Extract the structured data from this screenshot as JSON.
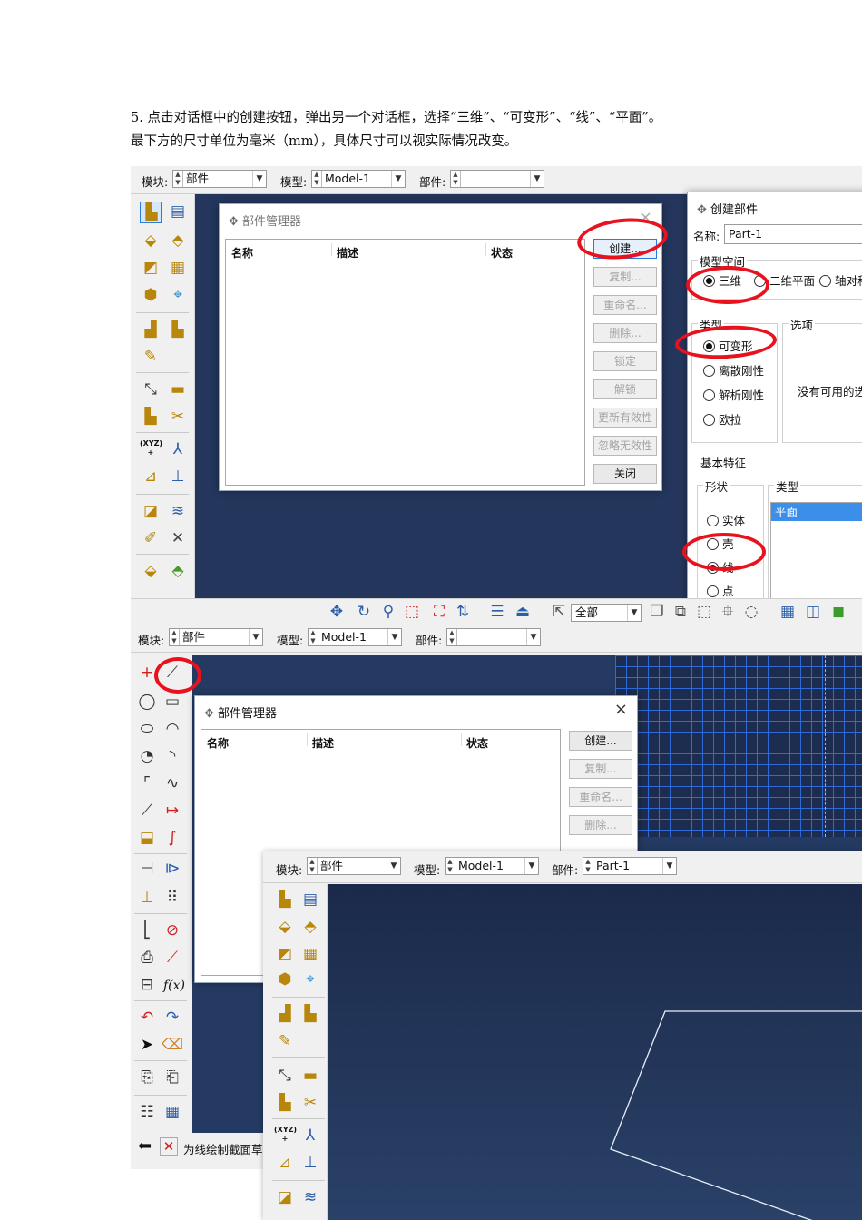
{
  "instructions": {
    "line1": "5. 点击对话框中的创建按钮，弹出另一个对话框，选择“三维”、“可变形”、“线”、“平面”。",
    "line2": "最下方的尺寸单位为毫米（mm），具体尺寸可以视实际情况改变。"
  },
  "context_bar": {
    "module_label": "模块:",
    "module_value": "部件",
    "model_label": "模型:",
    "model_value": "Model-1",
    "part_label": "部件:",
    "part_value": "",
    "part_value_3": "Part-1"
  },
  "part_manager": {
    "title": "部件管理器",
    "columns": [
      "名称",
      "描述",
      "状态"
    ],
    "buttons": [
      "创建...",
      "复制...",
      "重命名...",
      "删除...",
      "锁定",
      "解锁",
      "更新有效性",
      "忽略无效性",
      "关闭"
    ]
  },
  "create_part": {
    "title": "创建部件",
    "name_label": "名称:",
    "name_value": "Part-1",
    "space_group": "模型空间",
    "space_options": [
      "三维",
      "二维平面",
      "轴对称"
    ],
    "type_group": "类型",
    "type_options": [
      "可变形",
      "离散刚性",
      "解析刚性",
      "欧拉"
    ],
    "options_group": "选项",
    "options_text": "没有可用的选项",
    "base_feature": "基本特征",
    "shape_group": "形状",
    "shape_options": [
      "实体",
      "壳",
      "线",
      "点"
    ],
    "kind_group": "类型",
    "kind_selected": "平面"
  },
  "toolbar": {
    "filter_value": "全部"
  },
  "prompt": {
    "text": "为线绘制截面草"
  },
  "icons": {
    "sketch_icons": [
      "f(x)"
    ],
    "csys_label": "(XYZ)"
  },
  "colors": {
    "viewport_bg": "#1e2f52",
    "grid_line": "#2f6ad8",
    "annotation": "#e8121e"
  }
}
